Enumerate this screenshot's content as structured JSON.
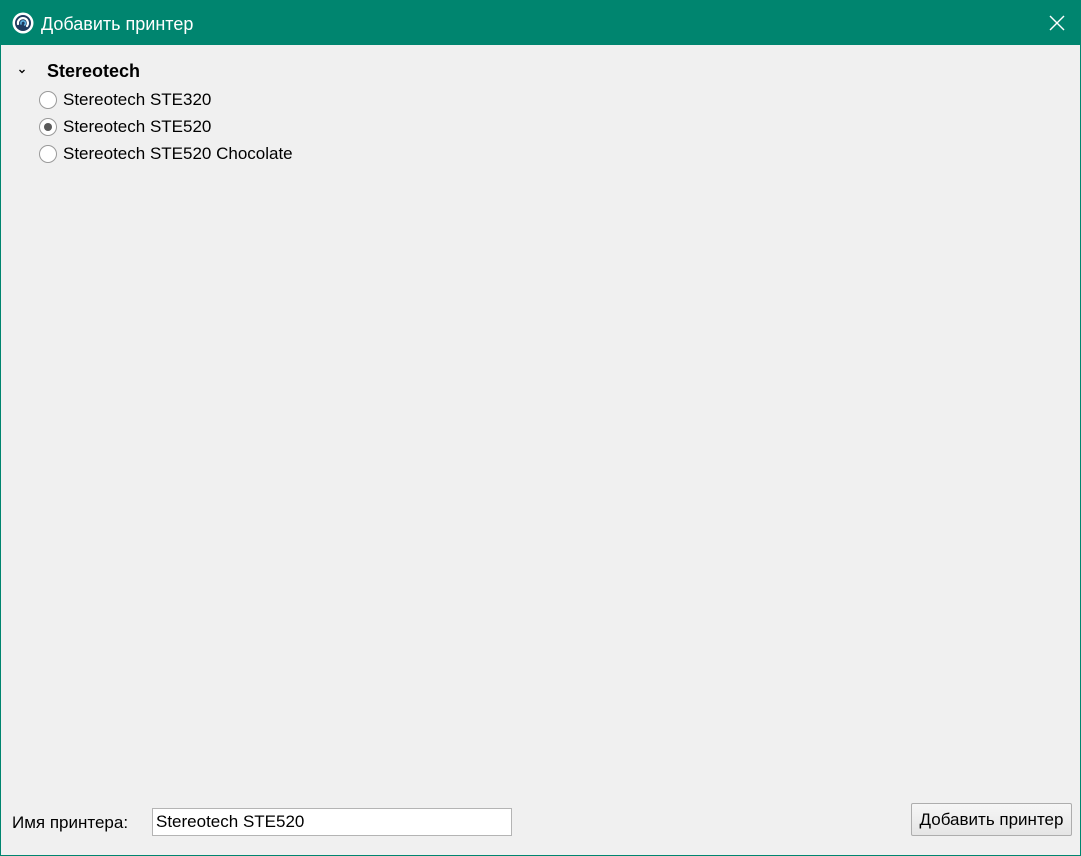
{
  "window": {
    "title": "Добавить принтер",
    "accent_color": "#00856f",
    "app_icon": "app-logo-icon",
    "close_icon": "close-icon"
  },
  "tree": {
    "group": {
      "label": "Stereotech",
      "expanded": true,
      "toggle_icon": "chevron-down-icon"
    },
    "options": [
      {
        "label": "Stereotech STE320",
        "selected": false
      },
      {
        "label": "Stereotech STE520",
        "selected": true
      },
      {
        "label": "Stereotech STE520 Chocolate",
        "selected": false
      }
    ]
  },
  "footer": {
    "name_label": "Имя принтера:",
    "name_value": "Stereotech STE520",
    "add_button_label": "Добавить принтер"
  }
}
